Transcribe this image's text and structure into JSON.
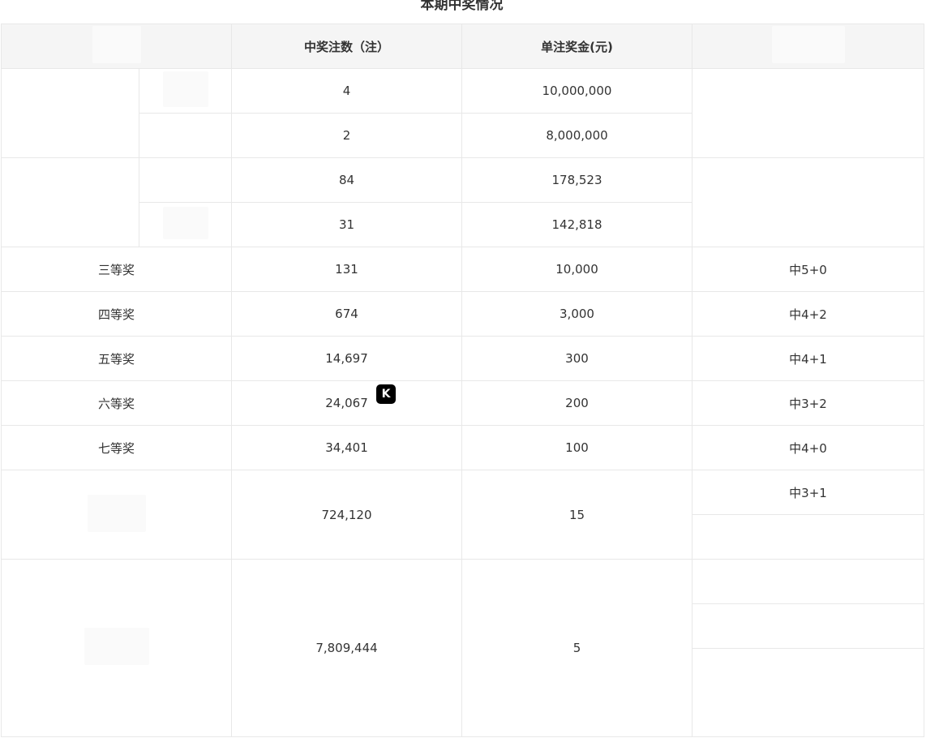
{
  "title": "本期中奖情况",
  "headers": {
    "col_count": "中奖注数（注）",
    "col_amount": "单注奖金(元)"
  },
  "first_prize": [
    {
      "count": "4",
      "amount": "10,000,000"
    },
    {
      "count": "2",
      "amount": "8,000,000"
    }
  ],
  "second_prize": [
    {
      "count": "84",
      "amount": "178,523"
    },
    {
      "count": "31",
      "amount": "142,818"
    }
  ],
  "rows": [
    {
      "level": "三等奖",
      "count": "131",
      "amount": "10,000",
      "rule": "中5+0"
    },
    {
      "level": "四等奖",
      "count": "674",
      "amount": "3,000",
      "rule": "中4+2"
    },
    {
      "level": "五等奖",
      "count": "14,697",
      "amount": "300",
      "rule": "中4+1"
    },
    {
      "level": "六等奖",
      "count": "24,067",
      "amount": "200",
      "rule": "中3+2"
    },
    {
      "level": "七等奖",
      "count": "34,401",
      "amount": "100",
      "rule": "中4+0"
    }
  ],
  "eighth": {
    "count": "724,120",
    "amount": "15",
    "rule_1": "中3+1"
  },
  "ninth": {
    "count": "7,809,444",
    "amount": "5"
  },
  "badge": {
    "icon": "k-badge-icon",
    "glyph": "K"
  }
}
